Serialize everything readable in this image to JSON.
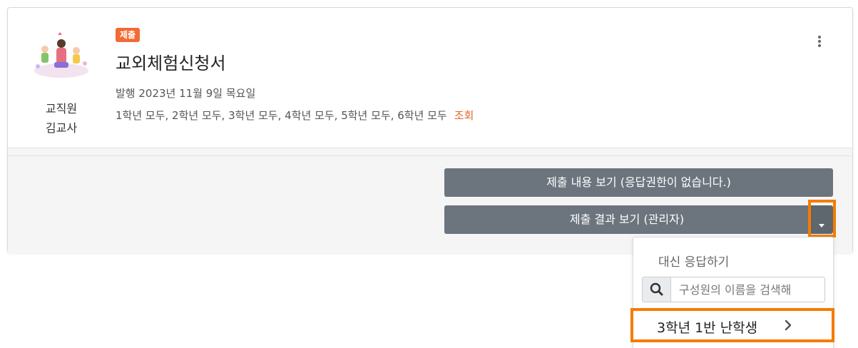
{
  "card": {
    "badge": "제출",
    "title": "교외체험신청서",
    "publish_info": "발행 2023년 11월 9일 목요일",
    "targets": "1학년 모두, 2학년 모두, 3학년 모두, 4학년 모두, 5학년 모두, 6학년 모두",
    "view_link": "조회",
    "author_role": "교직원",
    "author_name": "김교사",
    "menu_icon": "kebab-vertical-icon"
  },
  "actions": {
    "view_submission": "제출 내용 보기 (응답권한이 없습니다.)",
    "view_results": "제출 결과 보기 (관리자)"
  },
  "dropdown": {
    "header": "대신 응답하기",
    "search_placeholder": "구성원의 이름을 검색해",
    "member": "3학년 1반 난학생"
  },
  "colors": {
    "badge": "#f26a35",
    "link": "#e0692c",
    "button": "#6c757d",
    "highlight": "#f57c00"
  }
}
